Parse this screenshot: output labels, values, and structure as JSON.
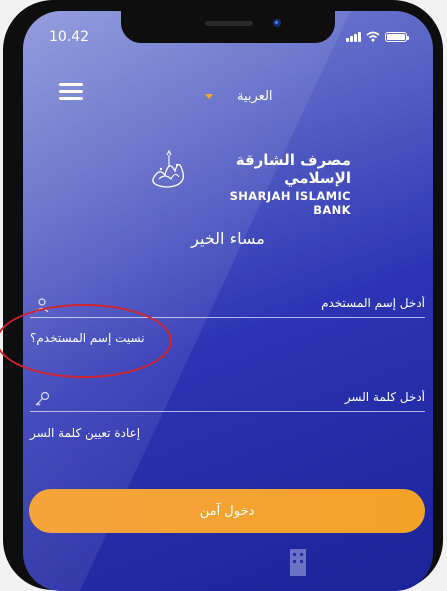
{
  "status_bar": {
    "time": "10.42",
    "signal_icon": "signal-icon",
    "wifi_icon": "wifi-icon",
    "battery_icon": "battery-icon"
  },
  "header": {
    "menu_icon": "hamburger-menu-icon",
    "language_label": "العربية",
    "dropdown_icon": "caret-down-icon"
  },
  "brand": {
    "name_ar": "مصرف الشارقة الإسلامي",
    "name_en": "SHARJAH ISLAMIC BANK",
    "logo_icon": "calligraphy-logo-icon"
  },
  "greeting": "مساء الخير",
  "form": {
    "username_placeholder": "أدخل إسم المستخدم",
    "username_icon": "user-icon",
    "forgot_username_label": "نسيت إسم المستخدم؟",
    "password_placeholder": "أدخل كلمة السر",
    "password_icon": "key-icon",
    "reset_password_label": "إعادة تعيين كلمة السر",
    "login_button_label": "دخول آمن"
  },
  "colors": {
    "accent": "#f5a623",
    "annotation": "#d4232a",
    "background_top": "#7c88d6",
    "background_bottom": "#1c2297"
  }
}
